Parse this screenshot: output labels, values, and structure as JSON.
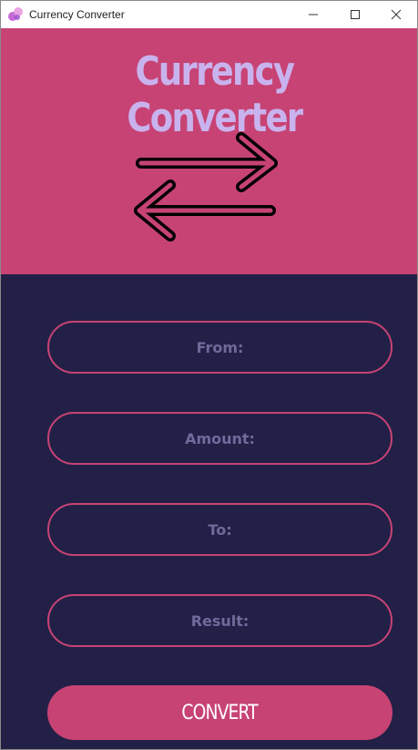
{
  "window": {
    "title": "Currency Converter",
    "controls": [
      "minimize-icon",
      "maximize-icon",
      "close-icon"
    ]
  },
  "header": {
    "title": "Currency Converter",
    "icon": "swap-arrows-icon"
  },
  "form": {
    "from_placeholder": "From:",
    "amount_placeholder": "Amount:",
    "to_placeholder": "To:",
    "result_placeholder": "Result:",
    "convert_label": "CONVERT"
  },
  "colors": {
    "background": "#222047",
    "accent": "#c74374",
    "title_text": "#c9b3ee",
    "placeholder_text": "#6f6b9b"
  }
}
